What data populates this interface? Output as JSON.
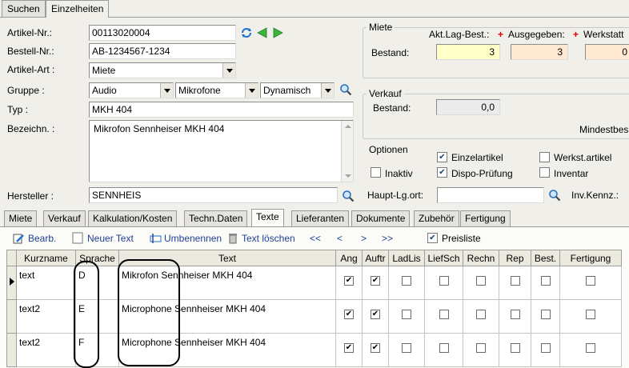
{
  "top_tabs": [
    {
      "label": "Suchen",
      "active": false
    },
    {
      "label": "Einzelheiten",
      "active": true
    }
  ],
  "form": {
    "artikel_nr_label": "Artikel-Nr.:",
    "artikel_nr": "00113020004",
    "bestell_nr_label": "Bestell-Nr.:",
    "bestell_nr": "AB-1234567-1234",
    "artikel_art_label": "Artikel-Art :",
    "artikel_art": "Miete",
    "gruppe_label": "Gruppe :",
    "gruppe_1": "Audio",
    "gruppe_2": "Mikrofone",
    "gruppe_3": "Dynamisch",
    "typ_label": "Typ :",
    "typ": "MKH 404",
    "bezeichnung_label": "Bezeichn. :",
    "bezeichnung": "Mikrofon Sennheiser MKH 404",
    "hersteller_label": "Hersteller :",
    "hersteller": "SENNHEIS"
  },
  "miete": {
    "title": "Miete",
    "akt_lag_best_label": "Akt.Lag-Best.:",
    "ausgegeben_label": "Ausgegeben:",
    "werkstatt_label": "Werkstatt",
    "bestand_label": "Bestand:",
    "akt_lag_best_value": "3",
    "ausgegeben_value": "3",
    "werkstatt_value": "0"
  },
  "verkauf": {
    "title": "Verkauf",
    "bestand_label": "Bestand:",
    "bestand_value": "0,0",
    "mindestbestand_label": "Mindestbes"
  },
  "optionen": {
    "title": "Optionen",
    "einzelartikel": "Einzelartikel",
    "werkst_artikel": "Werkst.artikel",
    "inaktiv": "Inaktiv",
    "dispo_pruefung": "Dispo-Prüfung",
    "inventar": "Inventar"
  },
  "haupt_lg_ort_label": "Haupt-Lg.ort:",
  "haupt_lg_ort_value": "",
  "inv_kennz_label": "Inv.Kennz.:",
  "sub_tabs": [
    {
      "label": "Miete"
    },
    {
      "label": "Verkauf"
    },
    {
      "label": "Kalkulation/Kosten"
    },
    {
      "label": "Techn.Daten"
    },
    {
      "label": "Texte"
    },
    {
      "label": "Lieferanten"
    },
    {
      "label": "Dokumente"
    },
    {
      "label": "Zubehör"
    },
    {
      "label": "Fertigung"
    }
  ],
  "toolbar": {
    "bearb": "Bearb.",
    "neuer_text": "Neuer Text",
    "umbenennen": "Umbenennen",
    "text_loeschen": "Text löschen",
    "first": "<<",
    "prev": "<",
    "next": ">",
    "last": ">>",
    "preisliste": "Preisliste"
  },
  "grid": {
    "columns": [
      "Kurzname",
      "Sprache",
      "Text",
      "Ang",
      "Auftr",
      "LadLis",
      "LiefSch",
      "Rechn",
      "Rep",
      "Best.",
      "Fertigung"
    ],
    "rows": [
      {
        "kurzname": "text",
        "sprache": "D",
        "text": "Mikrofon Sennheiser MKH 404"
      },
      {
        "kurzname": "text2",
        "sprache": "E",
        "text": "Microphone Sennheiser MKH 404"
      },
      {
        "kurzname": "text2",
        "sprache": "F",
        "text": "Microphone Sennheiser MKH 404"
      }
    ]
  },
  "colors": {
    "accent_blue": "#1f3f96",
    "yellow_field": "#ffffc8",
    "peach_field": "#fde8d2",
    "plus_red": "#e00000"
  }
}
